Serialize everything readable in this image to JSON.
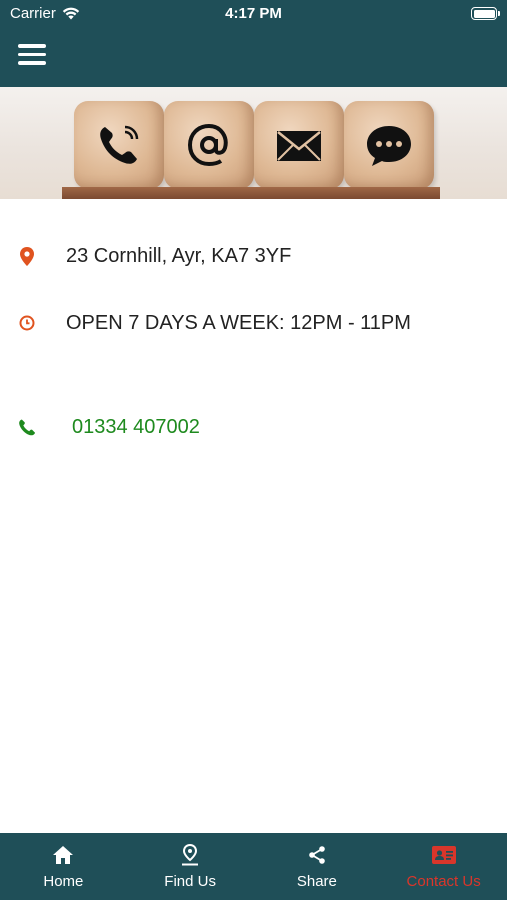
{
  "status_bar": {
    "carrier": "Carrier",
    "time": "4:17 PM"
  },
  "header": {
    "background_color": "#1f4f58"
  },
  "banner": {
    "icons": [
      "phone-icon",
      "at-sign-icon",
      "envelope-icon",
      "chat-bubble-icon"
    ]
  },
  "contact": {
    "address": "23 Cornhill, Ayr, KA7 3YF",
    "hours": "OPEN 7 DAYS A WEEK: 12PM - 11PM",
    "phone": "01334 407002",
    "accent_icon_color": "#e0531f",
    "phone_color": "#1e8a1e"
  },
  "tabs": [
    {
      "label": "Home",
      "icon": "home-icon",
      "active": false
    },
    {
      "label": "Find Us",
      "icon": "location-pin-icon",
      "active": false
    },
    {
      "label": "Share",
      "icon": "share-icon",
      "active": false
    },
    {
      "label": "Contact Us",
      "icon": "contact-card-icon",
      "active": true
    }
  ],
  "active_tab_color": "#d9362b"
}
